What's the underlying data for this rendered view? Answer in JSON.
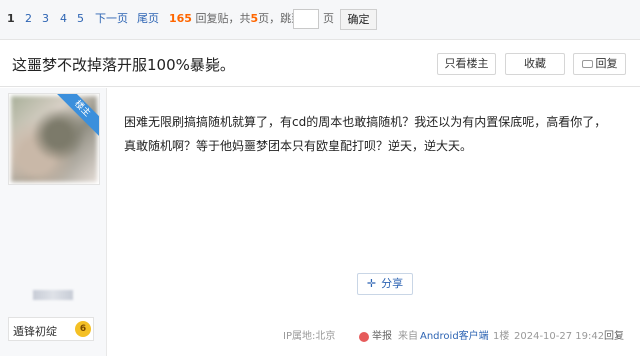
{
  "pager": {
    "pages": [
      "1",
      "2",
      "3",
      "4",
      "5"
    ],
    "next": "下一页",
    "last": "尾页",
    "reply_count": "165",
    "reply_label": "回复贴，共",
    "total_pages": "5",
    "pages_suffix": "页，跳到",
    "jump_input_value": "",
    "page_unit": "页",
    "confirm": "确定"
  },
  "thread": {
    "title": "这噩梦不改掉落开服100%暴毙。",
    "only_op": "只看楼主",
    "favorite": "收藏",
    "reply": "回复"
  },
  "author": {
    "op_tag": "楼主",
    "badge_name": "遁锋初绽",
    "level": "6"
  },
  "post": {
    "lines": [
      "困难无限刷搞搞随机就算了，有cd的周本也敢搞随机？我还以为有内置保底呢，高看你了，",
      "真敢随机啊？等于他妈噩梦团本只有欧皇配打呗？逆天，逆大天。"
    ],
    "share": "分享"
  },
  "footer": {
    "ip": "IP属地:北京",
    "report": "举报",
    "source_prefix": "来自",
    "source": "Android客户端",
    "floor": "1楼",
    "datetime": "2024-10-27 19:42",
    "reply": "回复"
  },
  "colors": {
    "link": "#2d64b3",
    "accent": "#ff6600",
    "op_ribbon": "#3b8fdc"
  }
}
